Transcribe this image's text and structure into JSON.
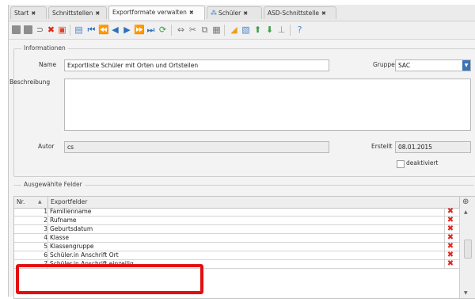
{
  "tabs": [
    {
      "label": "Start",
      "active": false,
      "icon": ""
    },
    {
      "label": "Schnittstellen",
      "active": false,
      "icon": ""
    },
    {
      "label": "Exportformate verwalten",
      "active": true,
      "icon": ""
    },
    {
      "label": "Schüler",
      "active": false,
      "icon": "students-icon"
    },
    {
      "label": "ASD-Schnittstelle",
      "active": false,
      "icon": ""
    }
  ],
  "info": {
    "legend": "Informationen",
    "name_label": "Name",
    "name_value": "Exportliste Schüler mit Orten und Ortsteilen",
    "gruppe_label": "Gruppe",
    "gruppe_value": "SAC",
    "beschreibung_label": "Beschreibung",
    "beschreibung_value": "",
    "autor_label": "Autor",
    "autor_value": "cs",
    "erstellt_label": "Erstellt",
    "erstellt_value": "08.01.2015",
    "deaktiviert_label": "deaktiviert"
  },
  "fields": {
    "legend": "Ausgewählte Felder",
    "col_nr": "Nr.",
    "col_export": "Exportfelder",
    "rows": [
      {
        "nr": "1",
        "name": "Familienname"
      },
      {
        "nr": "2",
        "name": "Rufname"
      },
      {
        "nr": "3",
        "name": "Geburtsdatum"
      },
      {
        "nr": "4",
        "name": "Klasse"
      },
      {
        "nr": "5",
        "name": "Klassengruppe"
      },
      {
        "nr": "6",
        "name": "Schüler.in Anschrift Ort"
      },
      {
        "nr": "7",
        "name": "Schüler.in Anschrift einzeilig"
      }
    ]
  },
  "colors": {
    "accent": "#3d74b8",
    "delete": "#e0271c",
    "highlight": "#e20f0f"
  }
}
